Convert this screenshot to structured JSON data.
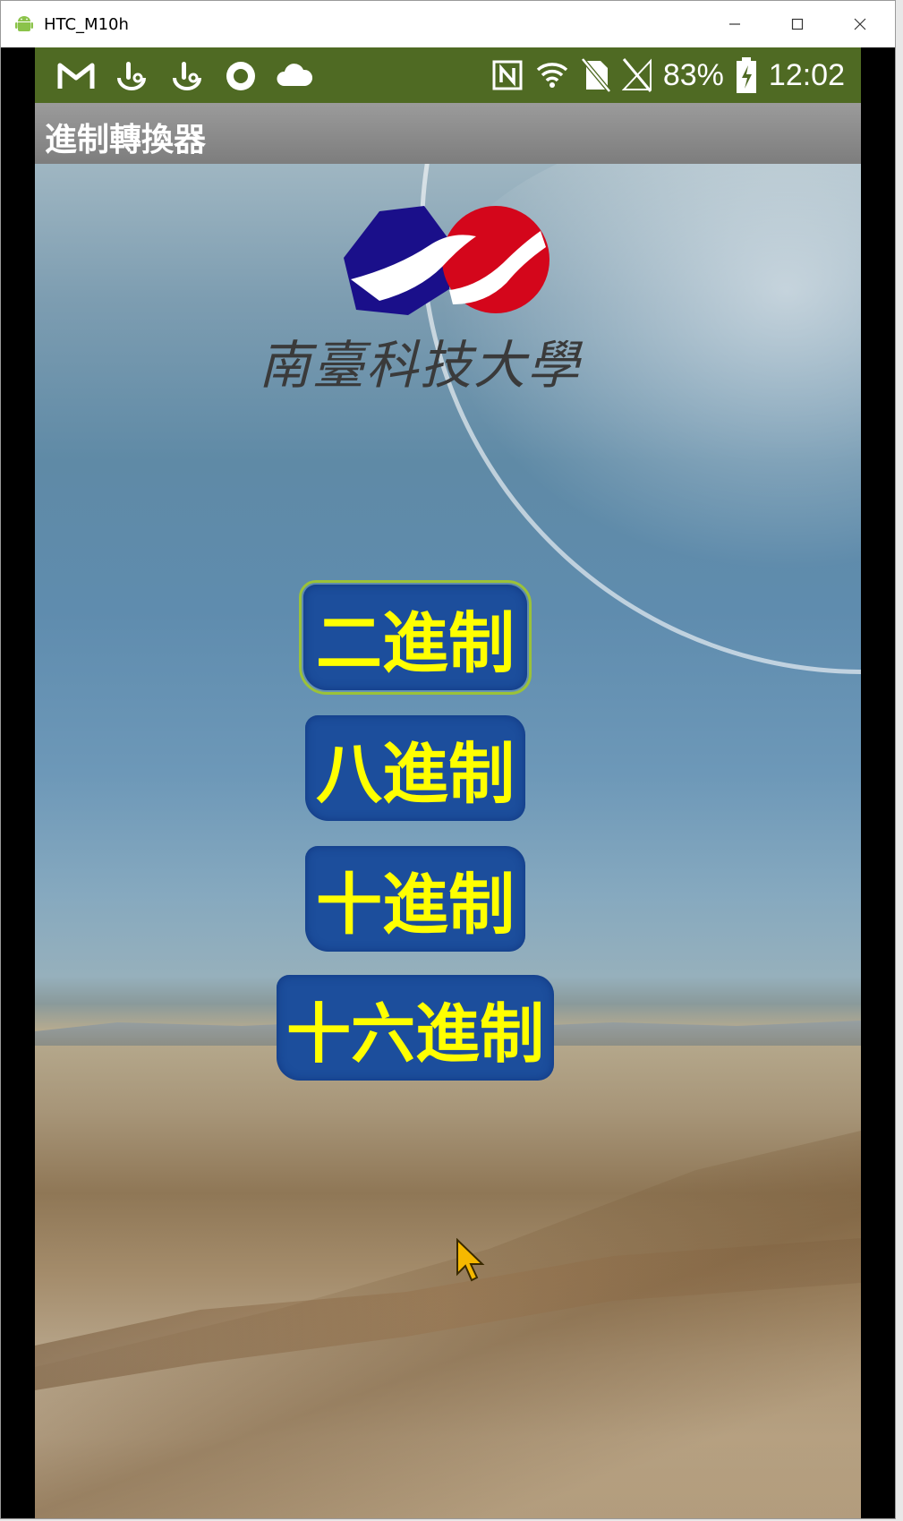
{
  "window": {
    "title": "HTC_M10h",
    "controls": [
      "minimize",
      "maximize",
      "close"
    ]
  },
  "status_bar": {
    "left_icons": [
      "gmail-icon",
      "touch-icon",
      "touch-icon",
      "record-icon",
      "cloud-icon"
    ],
    "right_icons": [
      "nfc-icon",
      "wifi-icon",
      "no-sim-icon",
      "signal-icon",
      "battery-charging-icon"
    ],
    "battery": "83%",
    "time": "12:02",
    "background_color": "#4f6a23"
  },
  "action_bar": {
    "title": "進制轉換器"
  },
  "logo": {
    "school_name": "南臺科技大學",
    "colors": {
      "left": "#1a0f8a",
      "right": "#d4061b"
    }
  },
  "buttons": [
    {
      "label": "二進制",
      "selected": true
    },
    {
      "label": "八進制",
      "selected": false
    },
    {
      "label": "十進制",
      "selected": false
    },
    {
      "label": "十六進制",
      "selected": false
    }
  ],
  "accent_colors": {
    "button_fill": "#1c4e9c",
    "button_text": "#ffff00",
    "focus_outline": "#9bc238"
  }
}
